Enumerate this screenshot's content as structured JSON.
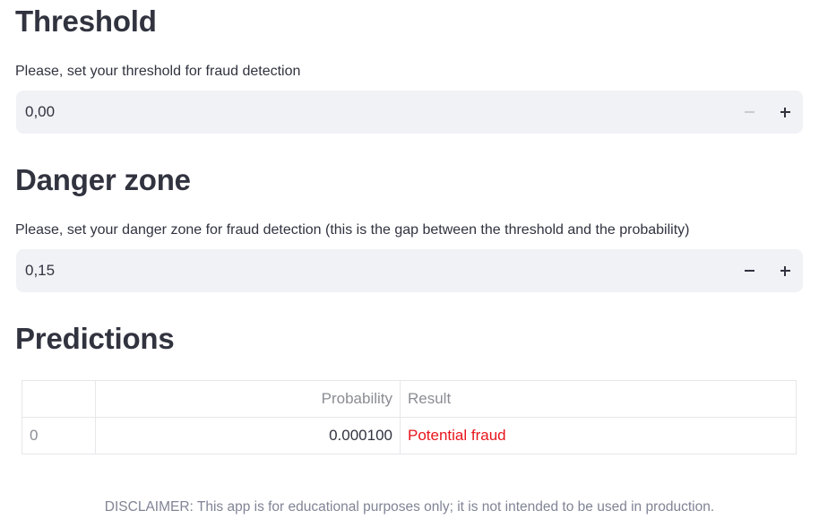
{
  "threshold": {
    "heading": "Threshold",
    "label": "Please, set your threshold for fraud detection",
    "value": "0,00",
    "decrement_label": "−",
    "increment_label": "+",
    "decrement_disabled": true
  },
  "danger_zone": {
    "heading": "Danger zone",
    "label": "Please, set your danger zone for fraud detection (this is the gap between the threshold and the probability)",
    "value": "0,15",
    "decrement_label": "−",
    "increment_label": "+",
    "decrement_disabled": false
  },
  "predictions": {
    "heading": "Predictions",
    "columns": [
      "",
      "Probability",
      "Result"
    ],
    "rows": [
      {
        "index": "0",
        "probability": "0.000100",
        "result": "Potential fraud"
      }
    ],
    "result_color": "#e8151c"
  },
  "disclaimer": "DISCLAIMER: This app is for educational purposes only; it is not intended to be used in production."
}
